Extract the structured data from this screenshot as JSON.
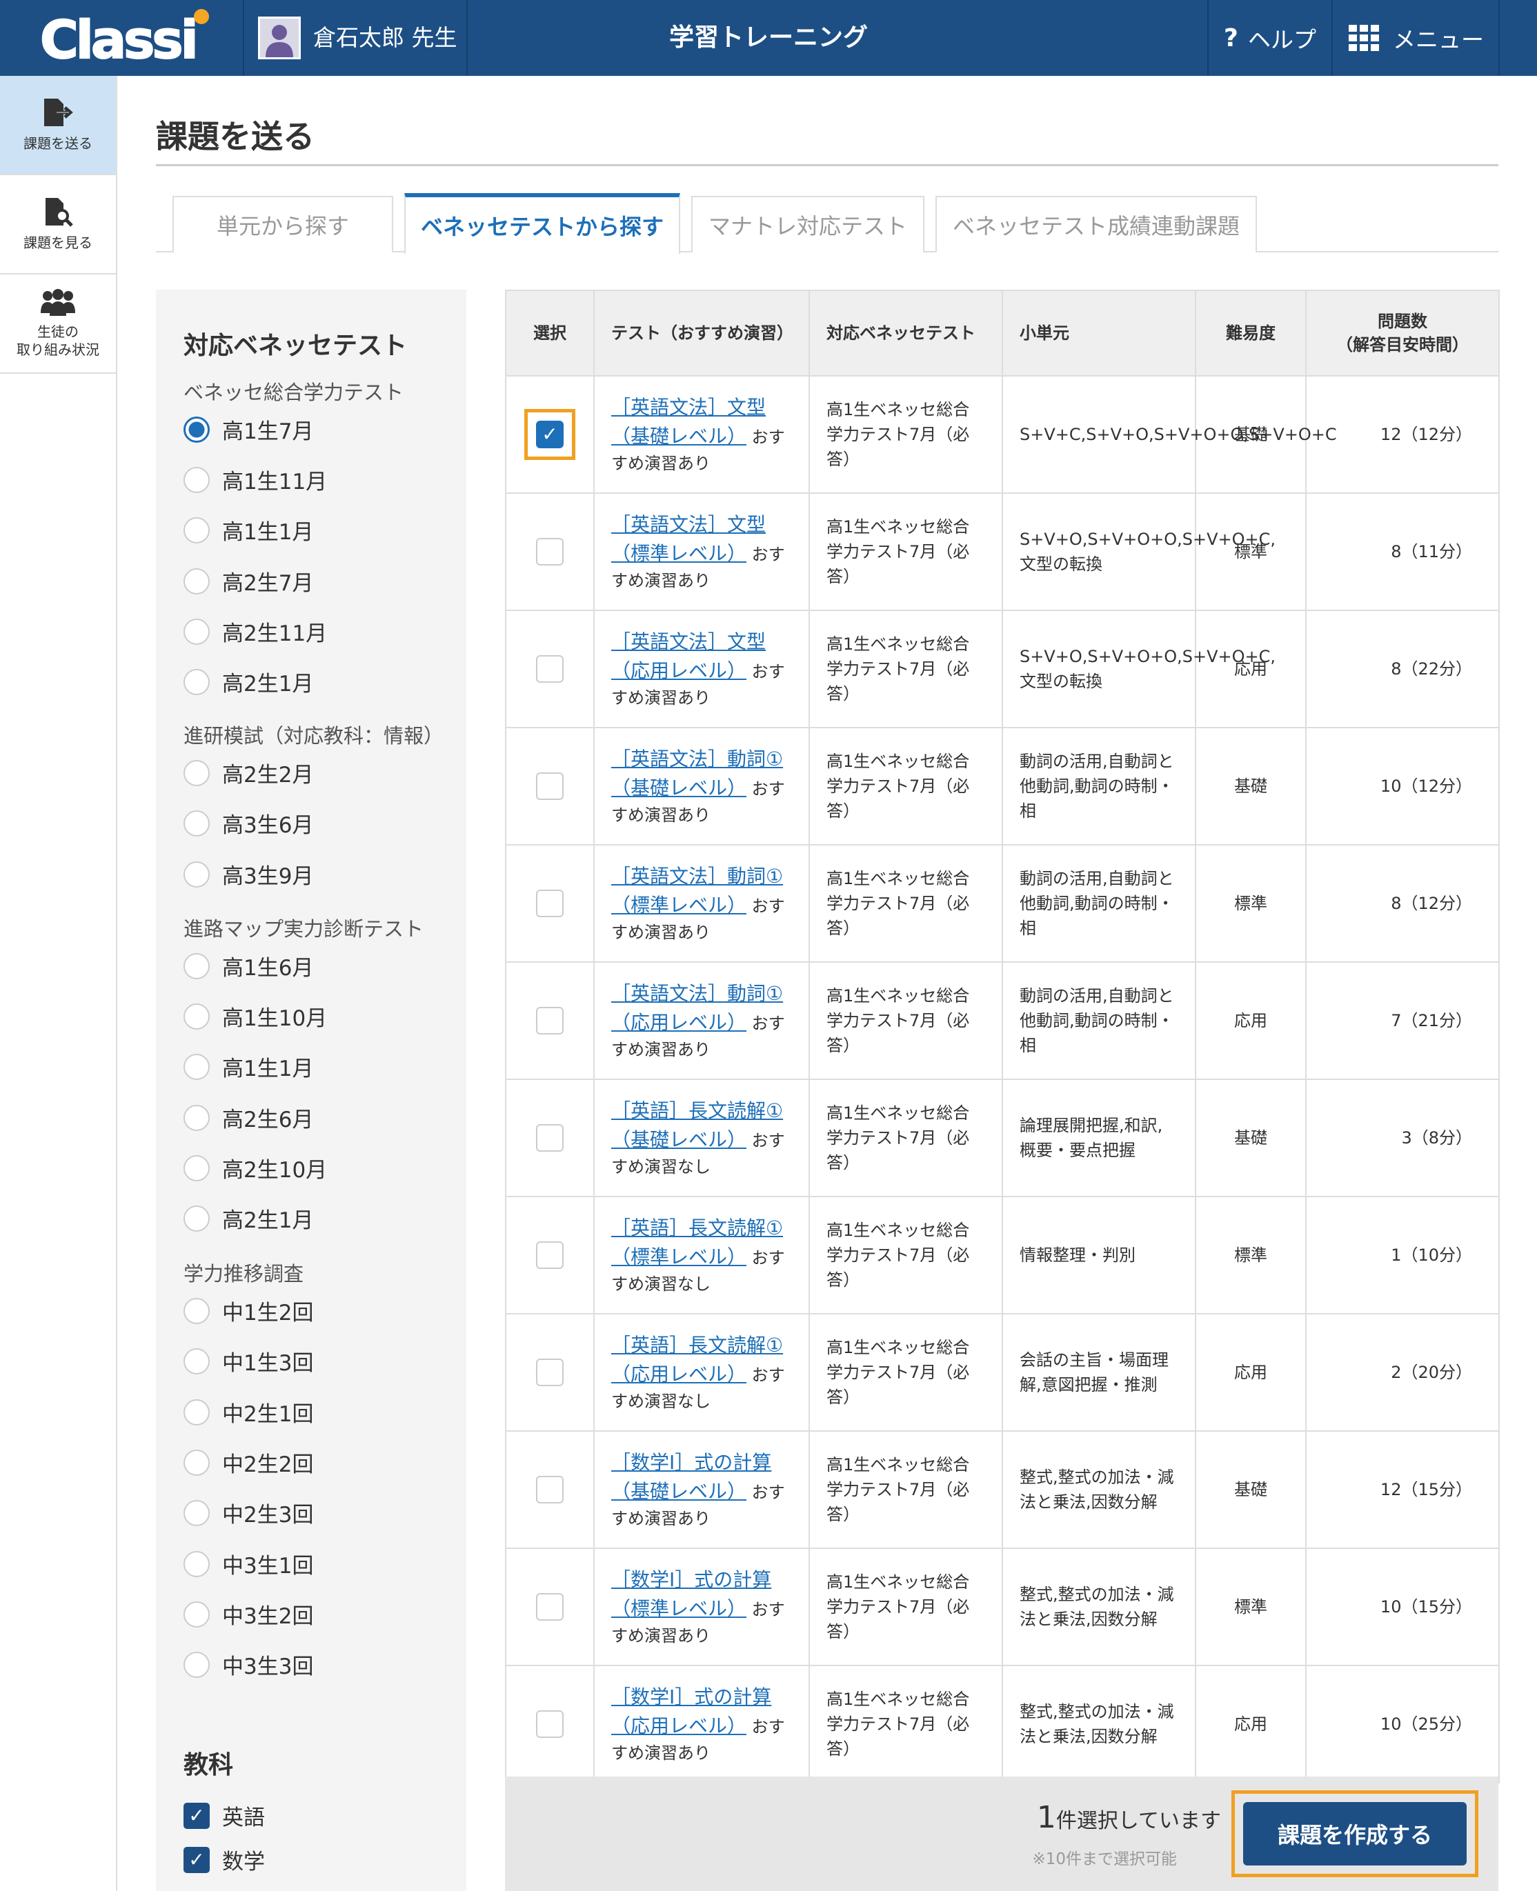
{
  "header": {
    "logo_text": "Classi",
    "user_name": "倉石太郎 先生",
    "title": "学習トレーニング",
    "help_label": "ヘルプ",
    "menu_label": "メニュー"
  },
  "sidebar": {
    "items": [
      {
        "label": "課題を送る",
        "icon": "send-assignment-icon",
        "active": true
      },
      {
        "label": "課題を見る",
        "icon": "view-assignment-icon",
        "active": false
      },
      {
        "label": "生徒の\n取り組み状況",
        "icon": "students-icon",
        "active": false
      }
    ]
  },
  "page": {
    "title": "課題を送る",
    "tabs": [
      {
        "label": "単元から探す",
        "active": false
      },
      {
        "label": "ベネッセテストから探す",
        "active": true
      },
      {
        "label": "マナトレ対応テスト",
        "active": false
      },
      {
        "label": "ベネッセテスト成績連動課題",
        "active": false
      }
    ]
  },
  "filter": {
    "heading": "対応ベネッセテスト",
    "groups": [
      {
        "label": "ベネッセ総合学力テスト",
        "options": [
          "高1生7月",
          "高1生11月",
          "高1生1月",
          "高2生7月",
          "高2生11月",
          "高2生1月"
        ],
        "selected": "高1生7月"
      },
      {
        "label": "進研模試（対応教科：情報）",
        "options": [
          "高2生2月",
          "高3生6月",
          "高3生9月"
        ]
      },
      {
        "label": "進路マップ実力診断テスト",
        "options": [
          "高1生6月",
          "高1生10月",
          "高1生1月",
          "高2生6月",
          "高2生10月",
          "高2生1月"
        ]
      },
      {
        "label": "学力推移調査",
        "options": [
          "中1生2回",
          "中1生3回",
          "中2生1回",
          "中2生2回",
          "中2生3回",
          "中3生1回",
          "中3生2回",
          "中3生3回"
        ]
      }
    ],
    "subject_heading": "教科",
    "subjects": [
      {
        "label": "英語",
        "checked": true
      },
      {
        "label": "数学",
        "checked": true
      }
    ]
  },
  "table": {
    "headers": [
      "選択",
      "テスト（おすすめ演習）",
      "対応ベネッセテスト",
      "小単元",
      "難易度",
      "問題数\n（解答目安時間）"
    ],
    "rows": [
      {
        "selected": true,
        "test_link": "［英語文法］文型（基礎レベル）",
        "test_note": "おすすめ演習あり",
        "benesse": "高1生ベネッセ総合学力テスト7月（必答）",
        "unit": "S+V+C,S+V+O,S+V+O+O,S+V+O+C",
        "difficulty": "基礎",
        "count": "12（12分）"
      },
      {
        "selected": false,
        "test_link": "［英語文法］文型（標準レベル）",
        "test_note": "おすすめ演習あり",
        "benesse": "高1生ベネッセ総合学力テスト7月（必答）",
        "unit": "S+V+O,S+V+O+O,S+V+O+C,文型の転換",
        "difficulty": "標準",
        "count": "8（11分）"
      },
      {
        "selected": false,
        "test_link": "［英語文法］文型（応用レベル）",
        "test_note": "おすすめ演習あり",
        "benesse": "高1生ベネッセ総合学力テスト7月（必答）",
        "unit": "S+V+O,S+V+O+O,S+V+O+C,文型の転換",
        "difficulty": "応用",
        "count": "8（22分）"
      },
      {
        "selected": false,
        "test_link": "［英語文法］動詞①（基礎レベル）",
        "test_note": "おすすめ演習あり",
        "benesse": "高1生ベネッセ総合学力テスト7月（必答）",
        "unit": "動詞の活用,自動詞と他動詞,動詞の時制・相",
        "difficulty": "基礎",
        "count": "10（12分）"
      },
      {
        "selected": false,
        "test_link": "［英語文法］動詞①（標準レベル）",
        "test_note": "おすすめ演習あり",
        "benesse": "高1生ベネッセ総合学力テスト7月（必答）",
        "unit": "動詞の活用,自動詞と他動詞,動詞の時制・相",
        "difficulty": "標準",
        "count": "8（12分）"
      },
      {
        "selected": false,
        "test_link": "［英語文法］動詞①（応用レベル）",
        "test_note": "おすすめ演習あり",
        "benesse": "高1生ベネッセ総合学力テスト7月（必答）",
        "unit": "動詞の活用,自動詞と他動詞,動詞の時制・相",
        "difficulty": "応用",
        "count": "7（21分）"
      },
      {
        "selected": false,
        "test_link": "［英語］長文読解①（基礎レベル）",
        "test_note": "おすすめ演習なし",
        "benesse": "高1生ベネッセ総合学力テスト7月（必答）",
        "unit": "論理展開把握,和訳,概要・要点把握",
        "difficulty": "基礎",
        "count": "3（8分）"
      },
      {
        "selected": false,
        "test_link": "［英語］長文読解①（標準レベル）",
        "test_note": "おすすめ演習なし",
        "benesse": "高1生ベネッセ総合学力テスト7月（必答）",
        "unit": "情報整理・判別",
        "difficulty": "標準",
        "count": "1（10分）"
      },
      {
        "selected": false,
        "test_link": "［英語］長文読解①（応用レベル）",
        "test_note": "おすすめ演習なし",
        "benesse": "高1生ベネッセ総合学力テスト7月（必答）",
        "unit": "会話の主旨・場面理解,意図把握・推測",
        "difficulty": "応用",
        "count": "2（20分）"
      },
      {
        "selected": false,
        "test_link": "［数学Ⅰ］式の計算（基礎レベル）",
        "test_note": "おすすめ演習あり",
        "benesse": "高1生ベネッセ総合学力テスト7月（必答）",
        "unit": "整式,整式の加法・減法と乗法,因数分解",
        "difficulty": "基礎",
        "count": "12（15分）"
      },
      {
        "selected": false,
        "test_link": "［数学Ⅰ］式の計算（標準レベル）",
        "test_note": "おすすめ演習あり",
        "benesse": "高1生ベネッセ総合学力テスト7月（必答）",
        "unit": "整式,整式の加法・減法と乗法,因数分解",
        "difficulty": "標準",
        "count": "10（15分）"
      },
      {
        "selected": false,
        "test_link": "［数学Ⅰ］式の計算（応用レベル）",
        "test_note": "おすすめ演習あり",
        "benesse": "高1生ベネッセ総合学力テスト7月（必答）",
        "unit": "整式,整式の加法・減法と乗法,因数分解",
        "difficulty": "応用",
        "count": "10（25分）"
      }
    ]
  },
  "footer": {
    "selected_num": "1",
    "selected_text": "件選択しています",
    "note": "※10件まで選択可能",
    "create_label": "課題を作成する"
  },
  "colors": {
    "header_bg": "#1d4f85",
    "accent": "#1d6fb8",
    "focus_outline": "#f0a020",
    "active_nav_bg": "#cde3f5"
  }
}
